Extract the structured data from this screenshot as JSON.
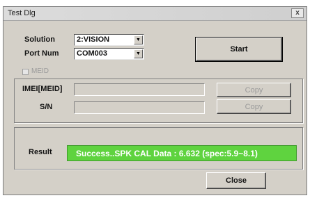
{
  "window": {
    "title": "Test Dlg",
    "close_glyph": "x"
  },
  "solution": {
    "label": "Solution",
    "value": "2:VISION"
  },
  "port": {
    "label": "Port Num",
    "value": "COM003"
  },
  "start_button": {
    "label": "Start"
  },
  "meid_checkbox": {
    "label": "MEID",
    "checked": false
  },
  "imei": {
    "label": "IMEI[MEID]",
    "value": "",
    "copy_label": "Copy"
  },
  "sn": {
    "label": "S/N",
    "value": "",
    "copy_label": "Copy"
  },
  "result": {
    "label": "Result",
    "text": "Success..SPK CAL Data : 6.632 (spec:5.9~8.1)",
    "status_color": "#5fd33f"
  },
  "close_button": {
    "label": "Close"
  },
  "icons": {
    "dropdown": "chevron-down-icon",
    "close": "close-icon"
  }
}
